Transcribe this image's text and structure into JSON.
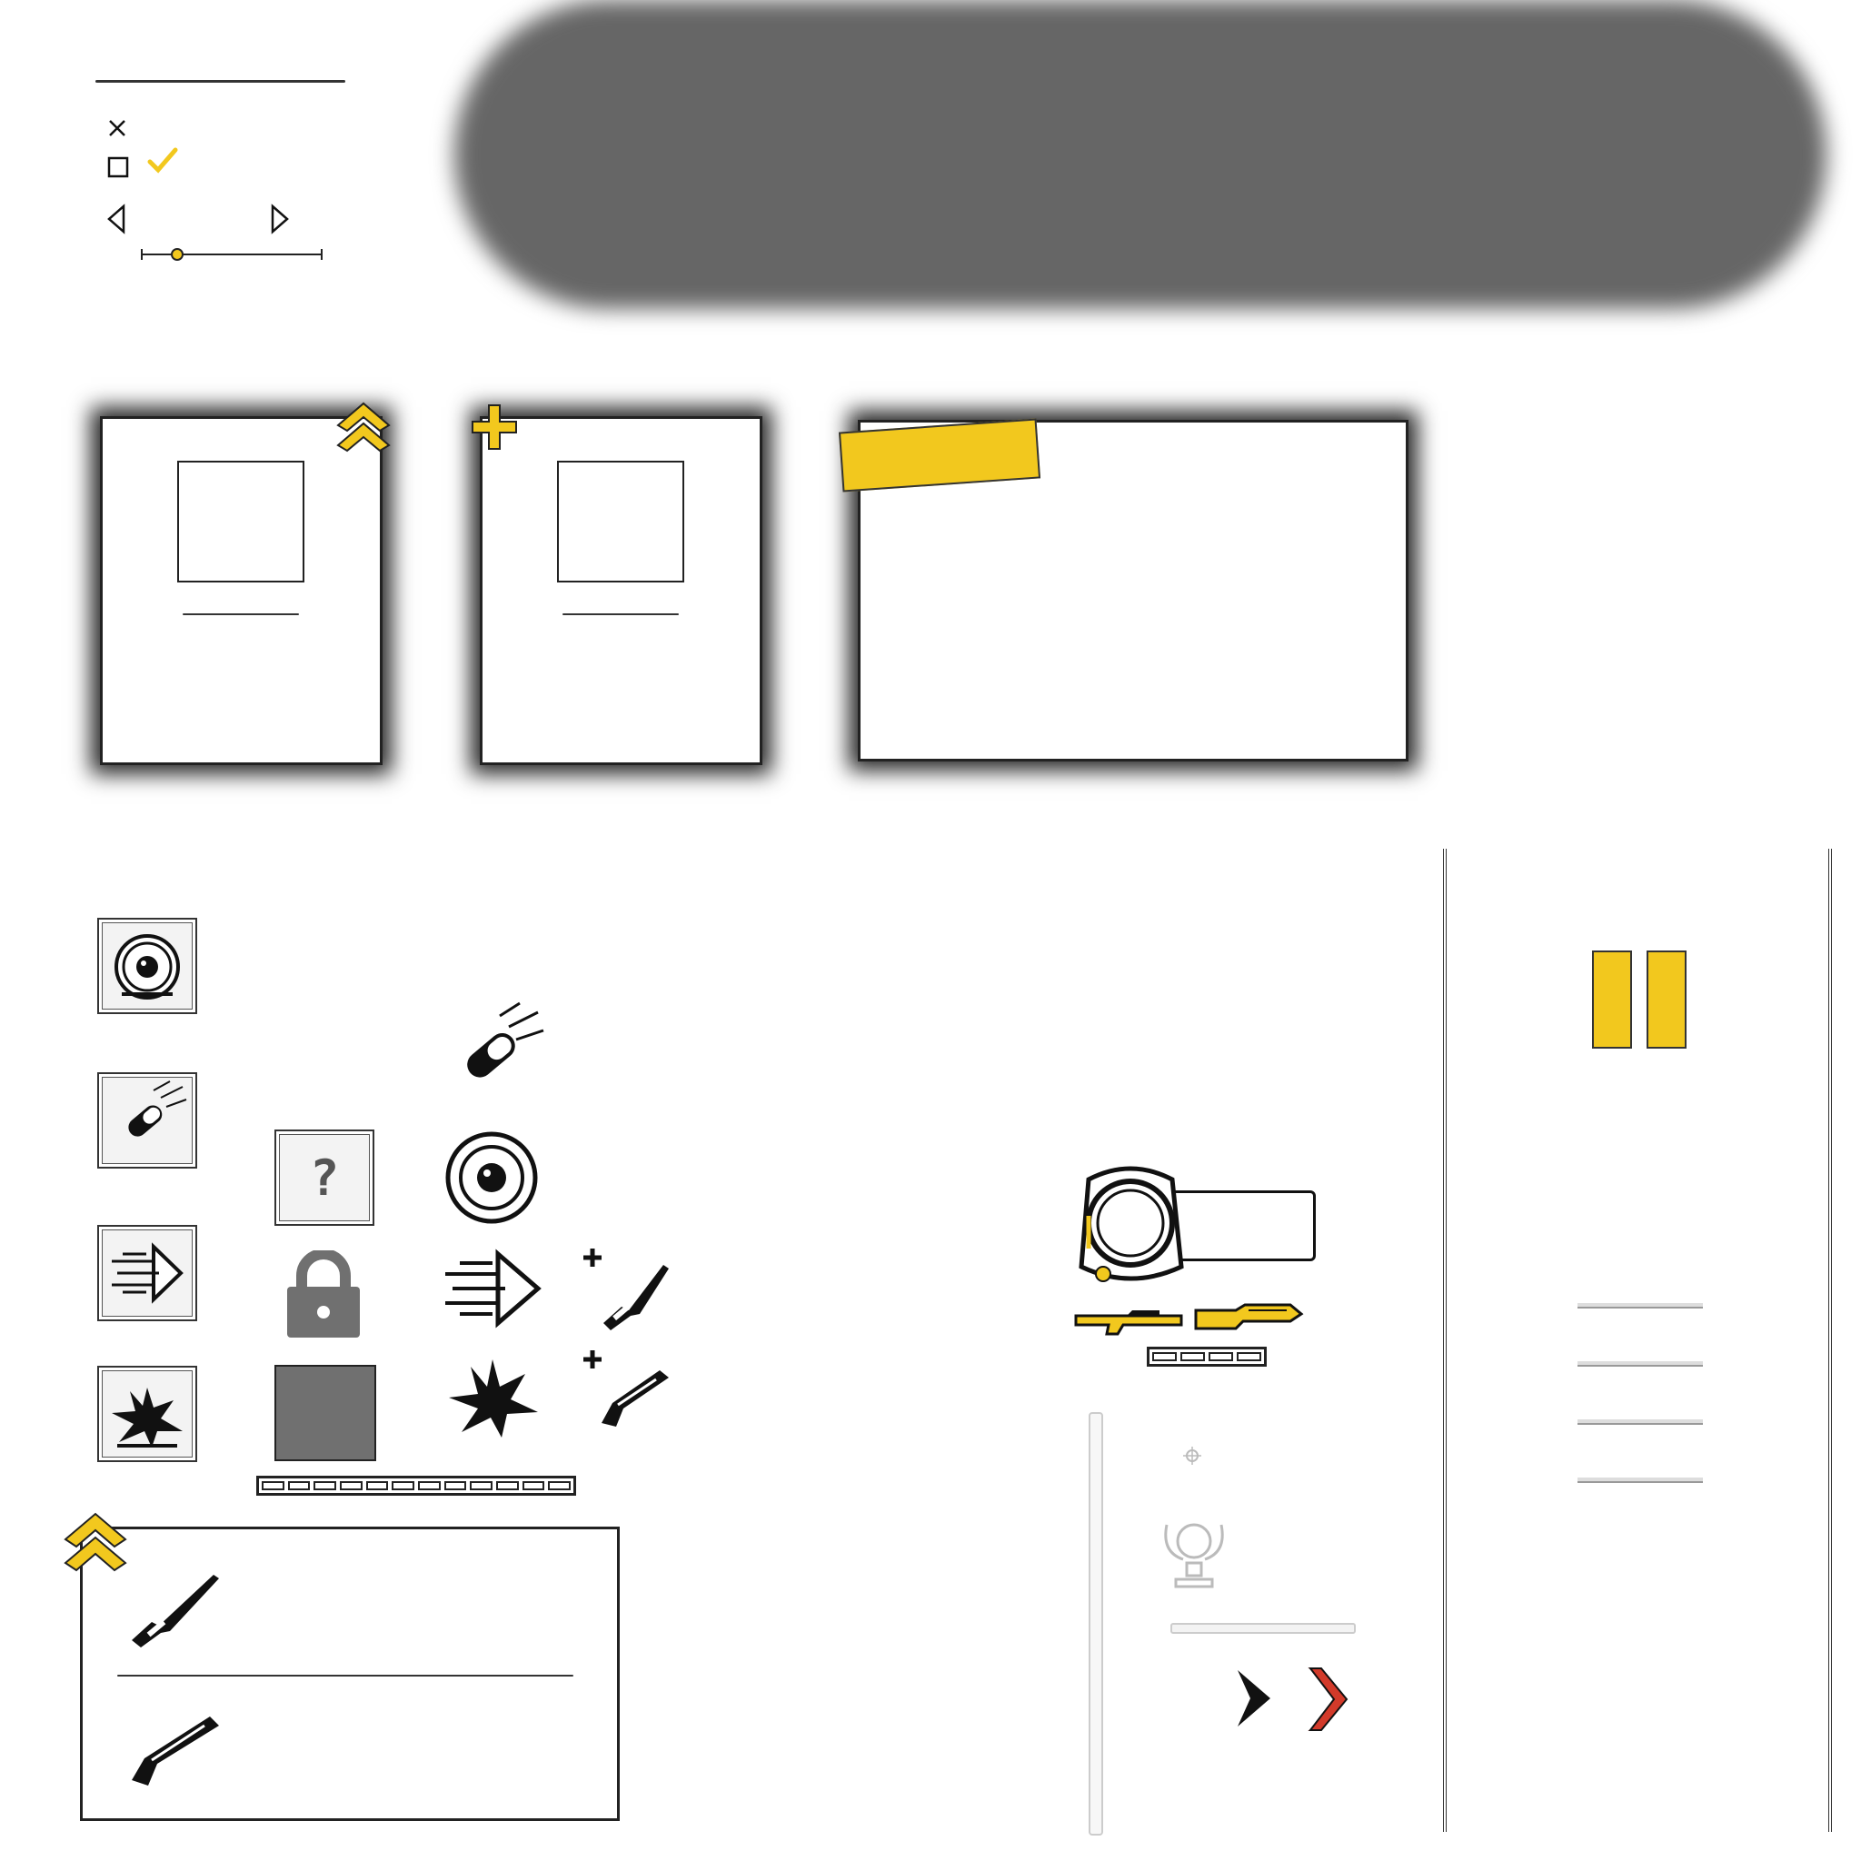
{
  "settings_widget": {
    "close_icon": "close-icon",
    "checkbox_icon": "checkbox-empty-icon",
    "check_icon": "checkmark-icon",
    "prev_icon": "triangle-left-icon",
    "next_icon": "triangle-right-icon",
    "slider_value": 0.2
  },
  "cards": {
    "upgrade_badge_icon": "double-chevron-up-icon",
    "add_badge_icon": "plus-icon",
    "tape_icon": "yellow-tape"
  },
  "ability_icons": [
    "helmet-icon",
    "bullet-icon",
    "dash-arrow-icon",
    "explosion-icon"
  ],
  "locked_slots": {
    "unknown_label": "?",
    "lock_icon": "padlock-icon"
  },
  "weapon_add_icons": [
    "plus-knife-icon",
    "plus-rifle-icon"
  ],
  "progress_segments": 12,
  "hud": {
    "ammo_segments": 4,
    "weapon_icons": [
      "rifle-icon",
      "knife-icon"
    ]
  },
  "pause": {
    "pause_icon": "pause-icon"
  },
  "nav_arrows": [
    "arrow-right-black-icon",
    "arrow-right-red-icon"
  ],
  "colors": {
    "accent_yellow": "#F2C81E",
    "ink": "#1A1A1A",
    "red": "#D23A2A",
    "lock_gray": "#707070",
    "blob_gray": "#666666"
  }
}
